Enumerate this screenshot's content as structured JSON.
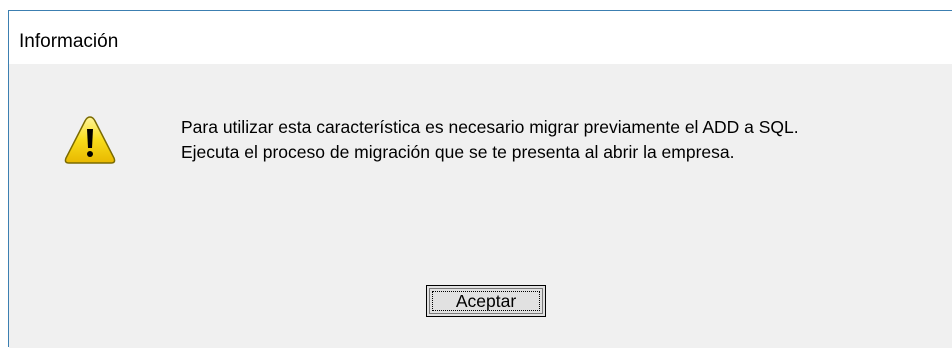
{
  "dialog": {
    "title": "Información",
    "icon": "warning-triangle-icon",
    "message_lines": [
      "Para utilizar esta característica es necesario migrar previamente el ADD a SQL.",
      "Ejecuta el proceso de migración que se te presenta al abrir la empresa."
    ],
    "ok_label": "Aceptar"
  },
  "colors": {
    "border": "#3c7fb1",
    "client_bg": "#f0f0f0",
    "warning_yellow": "#f5d000",
    "button_bg": "#e1e1e1"
  }
}
